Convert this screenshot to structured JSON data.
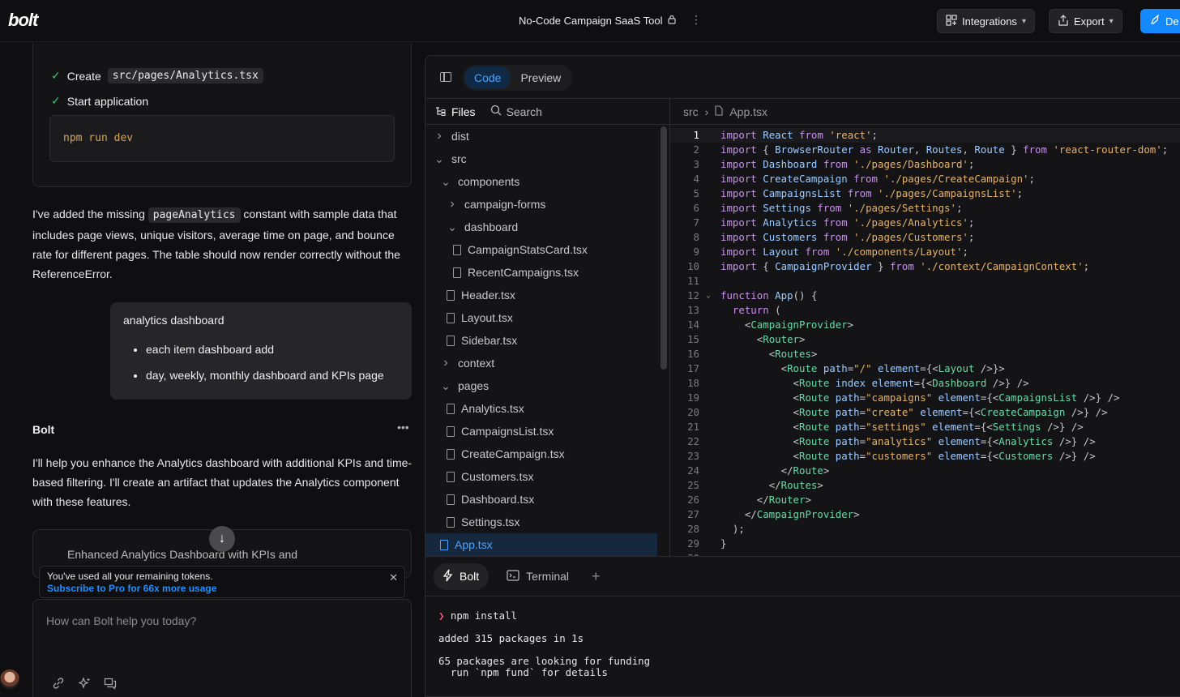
{
  "topbar": {
    "logo": "bolt",
    "project_title": "No-Code Campaign SaaS Tool",
    "integrations_label": "Integrations",
    "export_label": "Export",
    "deploy_label": "De"
  },
  "chat": {
    "steps": [
      {
        "label": "Create",
        "code": "src/pages/Analytics.tsx"
      },
      {
        "label": "Start application"
      }
    ],
    "command": "npm run dev",
    "assistant_msg_1_pre": "I've added the missing ",
    "assistant_msg_1_code": "pageAnalytics",
    "assistant_msg_1_post": " constant with sample data that includes page views, unique visitors, average time on page, and bounce rate for different pages. The table should now render correctly without the ReferenceError.",
    "user_msg": {
      "title": "analytics dashboard",
      "bullets": [
        "each item dashboard add",
        "day, weekly, monthly dashboard and KPIs page"
      ]
    },
    "assistant_name": "Bolt",
    "assistant_msg_2": "I'll help you enhance the Analytics dashboard with additional KPIs and time-based filtering. I'll create an artifact that updates the Analytics component with these features.",
    "artifact_title": "Enhanced Analytics Dashboard with KPIs and",
    "token_note": {
      "line1": "You've used all your remaining tokens.",
      "line2": "Subscribe to Pro for 66x more usage"
    },
    "input_placeholder": "How can Bolt help you today?"
  },
  "workbench": {
    "tabs": [
      "Code",
      "Preview"
    ],
    "active_tab": "Code",
    "files_label": "Files",
    "search_label": "Search",
    "breadcrumb": [
      "src",
      "App.tsx"
    ],
    "tree": [
      {
        "name": "dist",
        "type": "folder",
        "depth": 0,
        "open": false
      },
      {
        "name": "src",
        "type": "folder",
        "depth": 0,
        "open": true
      },
      {
        "name": "components",
        "type": "folder",
        "depth": 1,
        "open": true
      },
      {
        "name": "campaign-forms",
        "type": "folder",
        "depth": 2,
        "open": false
      },
      {
        "name": "dashboard",
        "type": "folder",
        "depth": 2,
        "open": true
      },
      {
        "name": "CampaignStatsCard.tsx",
        "type": "file",
        "depth": 3
      },
      {
        "name": "RecentCampaigns.tsx",
        "type": "file",
        "depth": 3
      },
      {
        "name": "Header.tsx",
        "type": "file",
        "depth": 2
      },
      {
        "name": "Layout.tsx",
        "type": "file",
        "depth": 2
      },
      {
        "name": "Sidebar.tsx",
        "type": "file",
        "depth": 2
      },
      {
        "name": "context",
        "type": "folder",
        "depth": 1,
        "open": false
      },
      {
        "name": "pages",
        "type": "folder",
        "depth": 1,
        "open": true
      },
      {
        "name": "Analytics.tsx",
        "type": "file",
        "depth": 2
      },
      {
        "name": "CampaignsList.tsx",
        "type": "file",
        "depth": 2
      },
      {
        "name": "CreateCampaign.tsx",
        "type": "file",
        "depth": 2
      },
      {
        "name": "Customers.tsx",
        "type": "file",
        "depth": 2
      },
      {
        "name": "Dashboard.tsx",
        "type": "file",
        "depth": 2
      },
      {
        "name": "Settings.tsx",
        "type": "file",
        "depth": 2
      },
      {
        "name": "App.tsx",
        "type": "file",
        "depth": 1,
        "selected": true
      }
    ],
    "code": [
      "import React from 'react';",
      "import { BrowserRouter as Router, Routes, Route } from 'react-router-dom';",
      "import Dashboard from './pages/Dashboard';",
      "import CreateCampaign from './pages/CreateCampaign';",
      "import CampaignsList from './pages/CampaignsList';",
      "import Settings from './pages/Settings';",
      "import Analytics from './pages/Analytics';",
      "import Customers from './pages/Customers';",
      "import Layout from './components/Layout';",
      "import { CampaignProvider } from './context/CampaignContext';",
      "",
      "function App() {",
      "  return (",
      "    <CampaignProvider>",
      "      <Router>",
      "        <Routes>",
      "          <Route path=\"/\" element={<Layout />}>",
      "            <Route index element={<Dashboard />} />",
      "            <Route path=\"campaigns\" element={<CampaignsList />} />",
      "            <Route path=\"create\" element={<CreateCampaign />} />",
      "            <Route path=\"settings\" element={<Settings />} />",
      "            <Route path=\"analytics\" element={<Analytics />} />",
      "            <Route path=\"customers\" element={<Customers />} />",
      "          </Route>",
      "        </Routes>",
      "      </Router>",
      "    </CampaignProvider>",
      "  );",
      "}",
      ""
    ],
    "bottom_tabs": [
      "Bolt",
      "Terminal"
    ],
    "terminal": {
      "command": "npm install",
      "lines": [
        "added 315 packages in 1s",
        "",
        "65 packages are looking for funding",
        "  run `npm fund` for details"
      ]
    }
  }
}
